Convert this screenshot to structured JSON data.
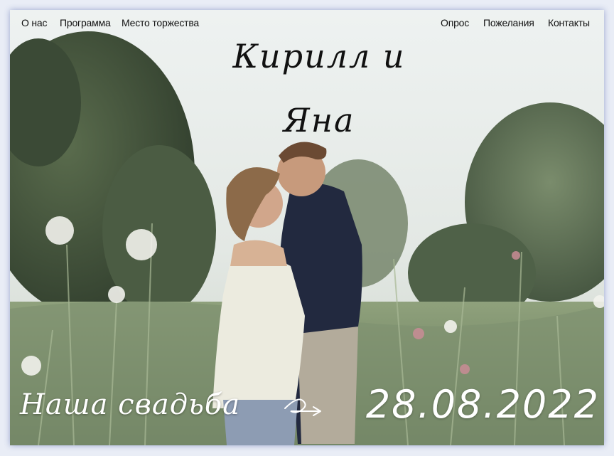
{
  "nav": {
    "left": [
      "О нас",
      "Программа",
      "Место торжества"
    ],
    "right": [
      "Опрос",
      "Пожелания",
      "Контакты"
    ]
  },
  "hero": {
    "couple_names": "Кирилл и Яна",
    "tagline": "Наша свадьба",
    "date": "28.08.2022"
  },
  "colors": {
    "accent": "#ffffff",
    "nav_text": "#111111"
  },
  "icons": {
    "arrow": "arrow-right-icon"
  }
}
